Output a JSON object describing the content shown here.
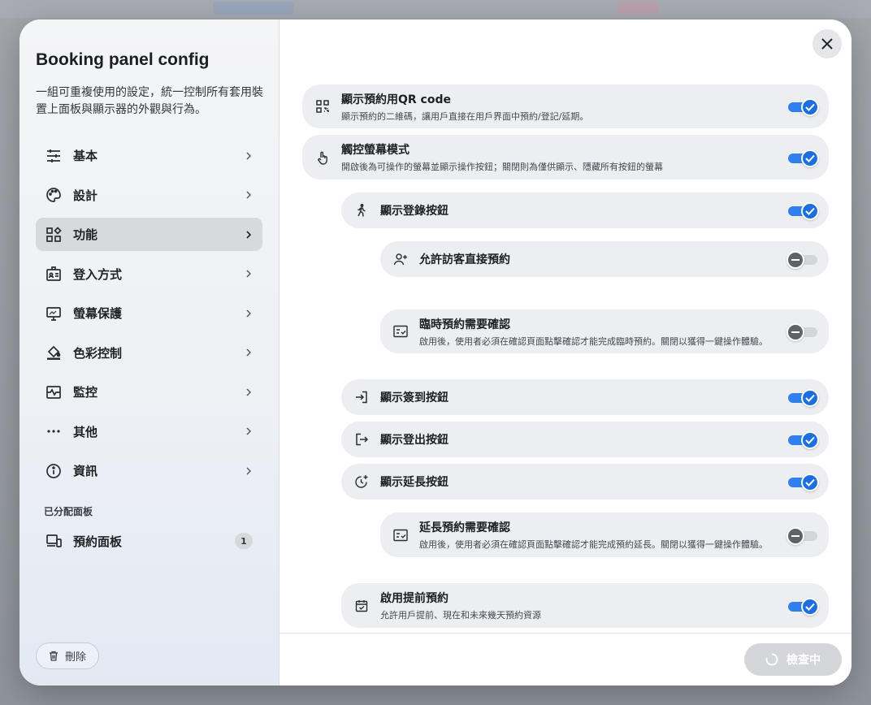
{
  "panel": {
    "title": "Booking panel config",
    "description": "一組可重複使用的設定，統一控制所有套用裝置上面板與顯示器的外觀與行為。"
  },
  "nav": {
    "items": [
      {
        "label": "基本",
        "icon": "sliders-icon"
      },
      {
        "label": "設計",
        "icon": "palette-icon"
      },
      {
        "label": "功能",
        "icon": "widgets-icon",
        "active": true
      },
      {
        "label": "登入方式",
        "icon": "badge-icon"
      },
      {
        "label": "螢幕保護",
        "icon": "monitor-icon"
      },
      {
        "label": "色彩控制",
        "icon": "paint-bucket-icon"
      },
      {
        "label": "監控",
        "icon": "monitoring-icon"
      },
      {
        "label": "其他",
        "icon": "more-dots-icon"
      },
      {
        "label": "資訊",
        "icon": "info-icon"
      }
    ],
    "section_label": "已分配面板",
    "assigned": {
      "label": "預約面板",
      "count": "1"
    }
  },
  "actions": {
    "delete_label": "刪除",
    "check_label": "檢查中"
  },
  "settings": [
    {
      "title": "顯示預約用QR code",
      "desc": "顯示預約的二維碼，讓用戶直接在用戶界面中預約/登記/延期。",
      "on": true
    },
    {
      "title": "觸控螢幕模式",
      "desc": "開啟後為可操作的螢幕並顯示操作按鈕；關閉則為僅供顯示、隱藏所有按鈕的螢幕",
      "on": true
    },
    {
      "title": "顯示登錄按鈕",
      "desc": "",
      "on": true
    },
    {
      "title": "允許訪客直接預約",
      "desc": "",
      "on": false
    },
    {
      "title": "臨時預約需要確認",
      "desc": "啟用後，使用者必須在確認頁面點擊確認才能完成臨時預約。關閉以獲得一鍵操作體驗。",
      "on": false
    },
    {
      "title": "顯示簽到按鈕",
      "desc": "",
      "on": true
    },
    {
      "title": "顯示登出按鈕",
      "desc": "",
      "on": true
    },
    {
      "title": "顯示延長按鈕",
      "desc": "",
      "on": true
    },
    {
      "title": "延長預約需要確認",
      "desc": "啟用後，使用者必須在確認頁面點擊確認才能完成預約延長。關閉以獲得一鍵操作體驗。",
      "on": false
    },
    {
      "title": "啟用提前預約",
      "desc": "允許用戶提前、現在和未來幾天預約資源",
      "on": true
    }
  ]
}
